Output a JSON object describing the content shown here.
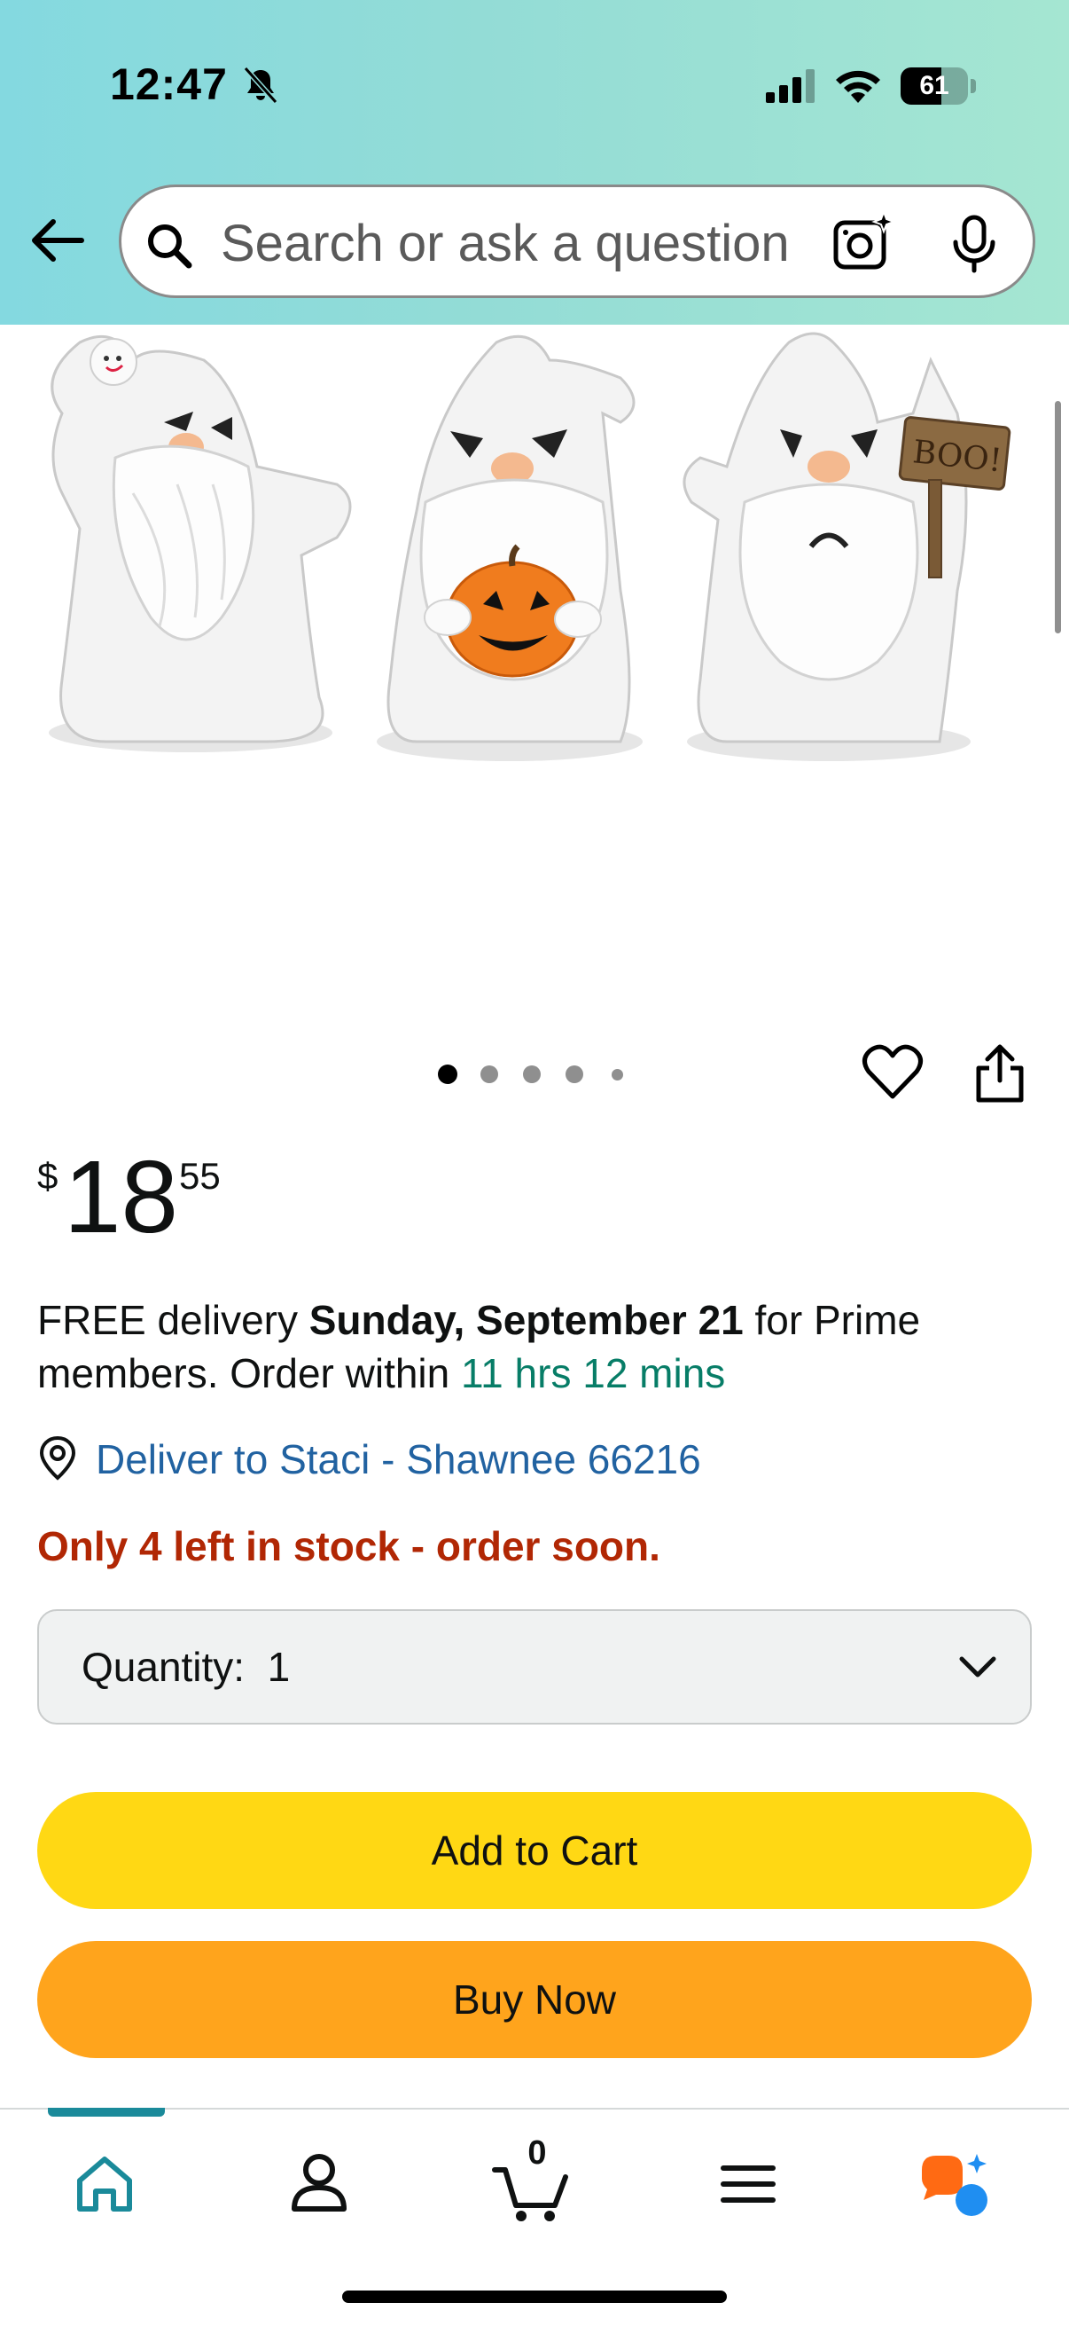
{
  "status_bar": {
    "time": "12:47",
    "battery": "61",
    "battery_fraction": 0.61
  },
  "search": {
    "placeholder": "Search or ask a question"
  },
  "carousel": {
    "total_dots": 5,
    "active_index": 0
  },
  "price": {
    "symbol": "$",
    "whole": "18",
    "fraction": "55"
  },
  "delivery": {
    "prefix": "FREE delivery ",
    "date": "Sunday, September 21",
    "middle": " for Prime members. Order within ",
    "countdown": "11 hrs 12 mins"
  },
  "deliver_to": {
    "label": "Deliver to Staci - Shawnee 66216"
  },
  "stock": {
    "message": "Only 4 left in stock - order soon."
  },
  "quantity": {
    "label": "Quantity:",
    "value": "1"
  },
  "buttons": {
    "add_to_cart": "Add to Cart",
    "buy_now": "Buy Now"
  },
  "tabbar": {
    "active_tab": "home",
    "cart_count": "0",
    "icons": [
      "home-icon",
      "account-icon",
      "cart-icon",
      "menu-icon",
      "rufus-icon"
    ]
  },
  "colors": {
    "header_gradient_start": "#84d9e0",
    "header_gradient_end": "#a5e6d2",
    "add_to_cart": "#ffd814",
    "buy_now": "#ffa41c",
    "stock_warning": "#b12704",
    "countdown_green": "#077d67",
    "link_blue": "#2162a1",
    "tab_active": "#1a8a9a"
  }
}
